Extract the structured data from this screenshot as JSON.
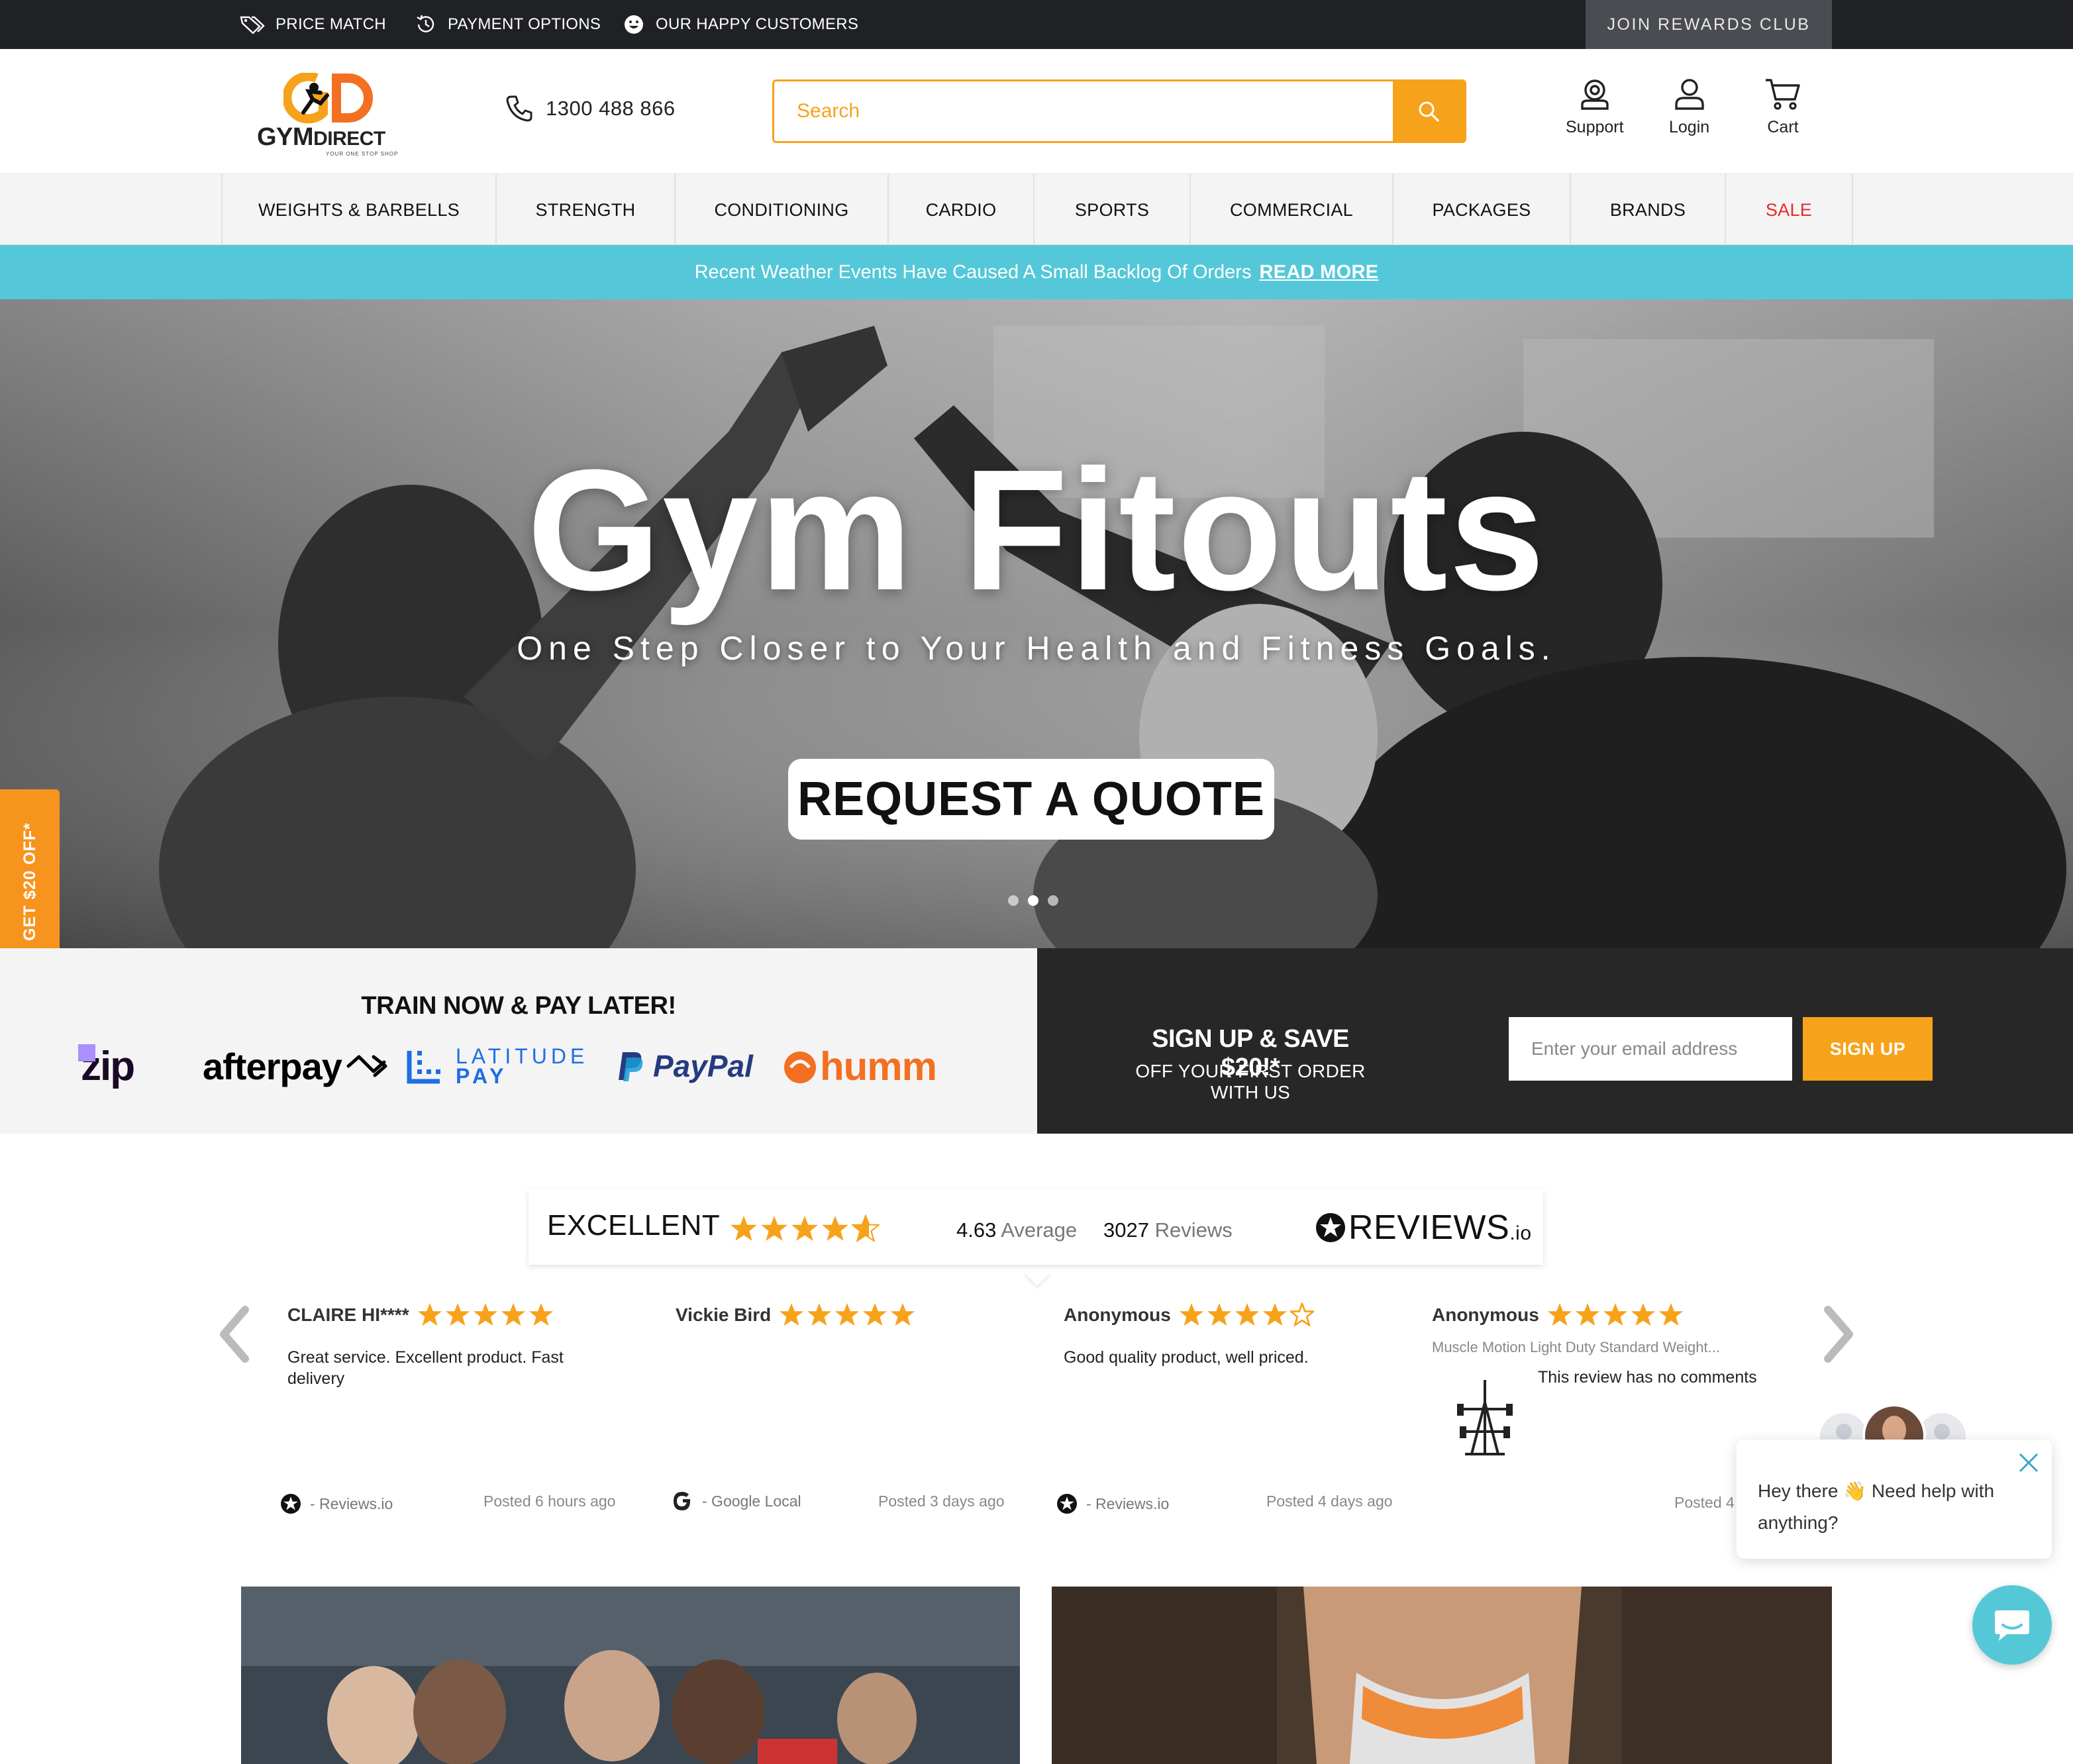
{
  "topbar": {
    "price_match": "PRICE MATCH",
    "payment_options": "PAYMENT OPTIONS",
    "happy_customers": "OUR HAPPY CUSTOMERS",
    "rewards": "JOIN REWARDS CLUB"
  },
  "header": {
    "logo_text_a": "GYM",
    "logo_text_b": "DIRECT",
    "logo_tagline": "YOUR ONE STOP SHOP",
    "phone": "1300 488 866",
    "search_placeholder": "Search",
    "support": "Support",
    "login": "Login",
    "cart": "Cart"
  },
  "nav": [
    {
      "label": "WEIGHTS & BARBELLS"
    },
    {
      "label": "STRENGTH"
    },
    {
      "label": "CONDITIONING"
    },
    {
      "label": "CARDIO"
    },
    {
      "label": "SPORTS"
    },
    {
      "label": "COMMERCIAL"
    },
    {
      "label": "PACKAGES"
    },
    {
      "label": "BRANDS"
    },
    {
      "label": "SALE"
    }
  ],
  "notice": {
    "text": "Recent Weather Events Have Caused A Small Backlog Of Orders",
    "link": "READ MORE"
  },
  "hero": {
    "title": "Gym Fitouts",
    "subtitle": "One Step Closer to Your Health and Fitness Goals.",
    "cta": "REQUEST A QUOTE",
    "slide_count": 3,
    "active_slide": 2
  },
  "side_tab": "GET $20 OFF*",
  "pay_later": {
    "title": "TRAIN NOW & PAY LATER!",
    "providers": [
      "zip",
      "afterpay",
      "LATITUDE",
      "PAY",
      "PayPal",
      "humm"
    ]
  },
  "signup": {
    "title": "SIGN UP & SAVE $20!*",
    "subtitle": "OFF YOUR FIRST ORDER WITH US",
    "email_placeholder": "Enter your email address",
    "button": "SIGN UP"
  },
  "reviews_summary": {
    "label": "EXCELLENT",
    "rating_stars": 4.63,
    "average": "4.63",
    "average_label": "Average",
    "count": "3027",
    "count_label": "Reviews",
    "brand": "REVIEWS",
    "brand_suffix": ".io"
  },
  "reviews": [
    {
      "name": "CLAIRE HI****",
      "stars": 5,
      "text": "Great service. Excellent product. Fast delivery",
      "source": "- Reviews.io",
      "posted": "Posted 6 hours ago"
    },
    {
      "name": "Vickie Bird",
      "stars": 5,
      "text": "",
      "source": "- Google Local",
      "posted": "Posted 3 days ago"
    },
    {
      "name": "Anonymous",
      "stars": 4,
      "text": "Good quality product, well priced.",
      "source": "- Reviews.io",
      "posted": "Posted 4 days ago"
    },
    {
      "name": "Anonymous",
      "stars": 5,
      "product": "Muscle Motion Light Duty Standard Weight...",
      "text": "This review has no comments",
      "posted": "Posted 4"
    }
  ],
  "chat": {
    "message_a": "Hey there ",
    "emoji": "👋",
    "message_b": " Need help with anything?"
  },
  "colors": {
    "accent": "#f7a21b",
    "topbar": "#1f2125",
    "notice": "#54c8d8",
    "sale": "#e32b2b",
    "signup_bg": "#272727",
    "star": "#f7a21b"
  }
}
